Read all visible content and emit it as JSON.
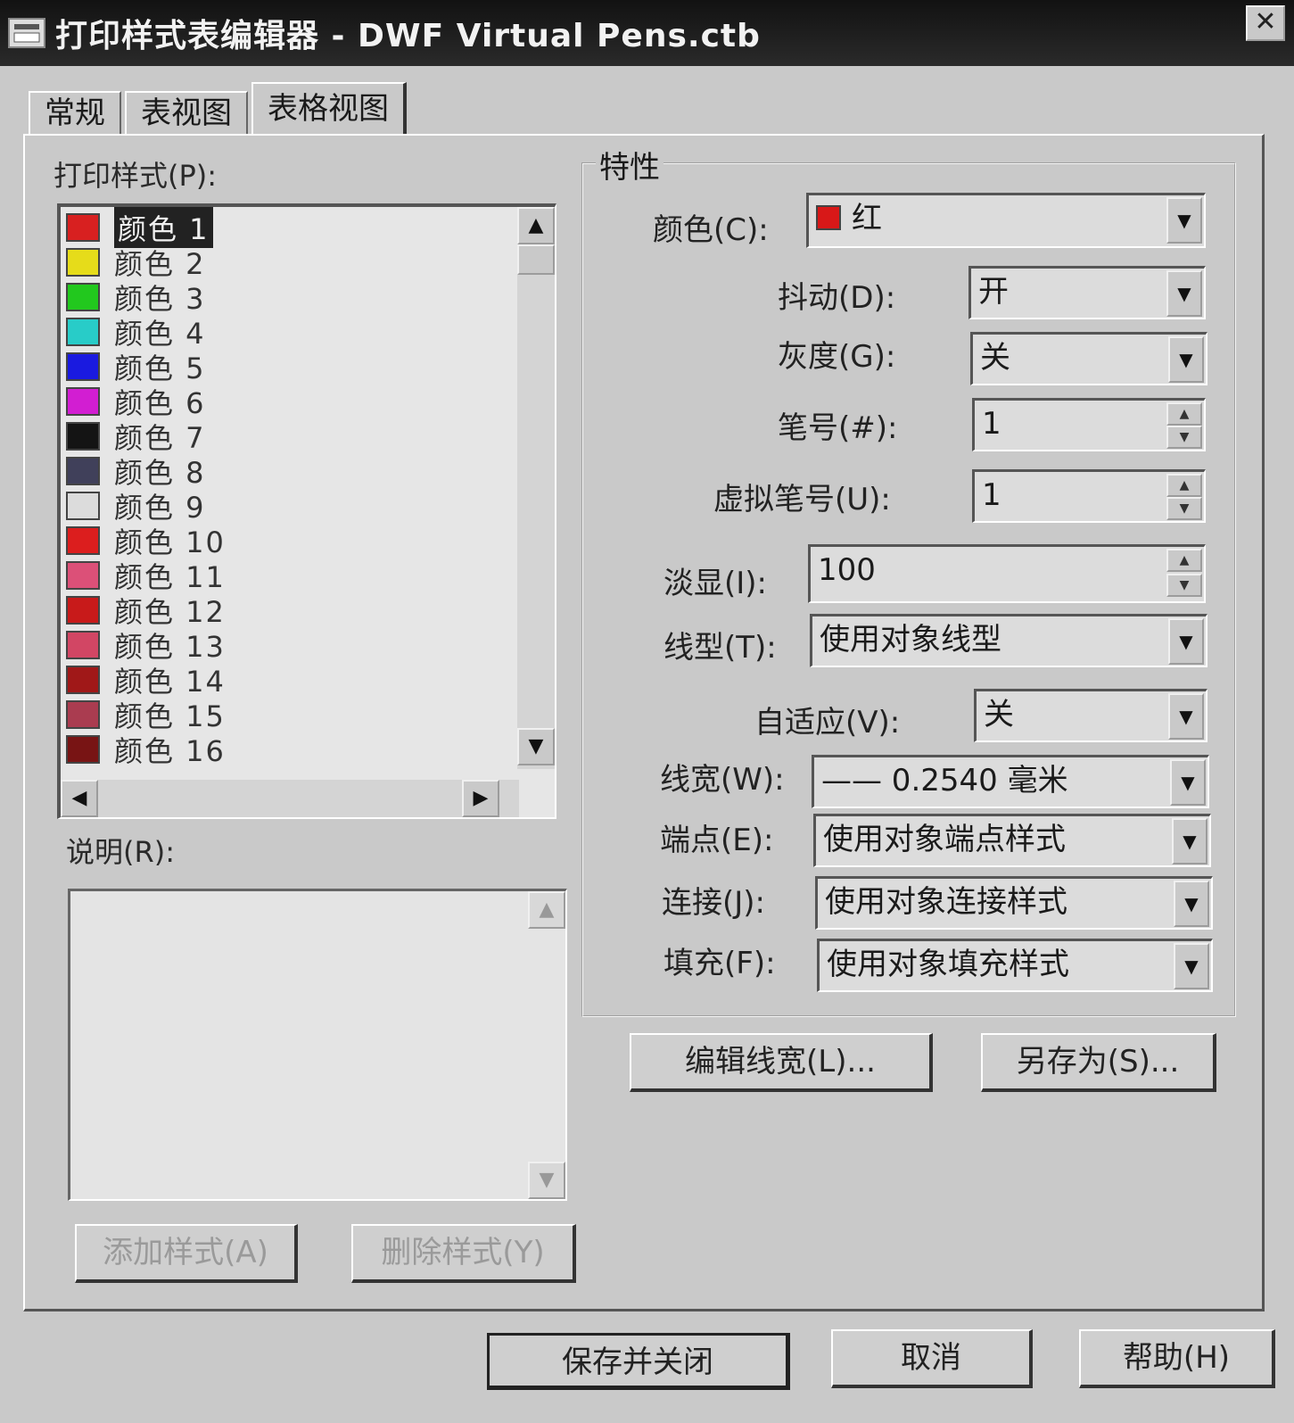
{
  "window": {
    "title": "打印样式表编辑器 - DWF Virtual Pens.ctb",
    "close_label": "✕"
  },
  "tabs": [
    {
      "label": "常规",
      "active": false
    },
    {
      "label": "表视图",
      "active": false
    },
    {
      "label": "表格视图",
      "active": true
    }
  ],
  "styles_panel": {
    "label": "打印样式(P):",
    "items": [
      {
        "name": "颜色 1",
        "color": "#d82020",
        "selected": true
      },
      {
        "name": "颜色 2",
        "color": "#e6dc1a"
      },
      {
        "name": "颜色 3",
        "color": "#22c81e"
      },
      {
        "name": "颜色 4",
        "color": "#28ccc8"
      },
      {
        "name": "颜色 5",
        "color": "#1a1ae0"
      },
      {
        "name": "颜色 6",
        "color": "#d21ed2"
      },
      {
        "name": "颜色 7",
        "color": "#141414"
      },
      {
        "name": "颜色 8",
        "color": "#40405a"
      },
      {
        "name": "颜色 9",
        "color": "#dcdcdc"
      },
      {
        "name": "颜色 10",
        "color": "#dc1e1e"
      },
      {
        "name": "颜色 11",
        "color": "#dc5078"
      },
      {
        "name": "颜色 12",
        "color": "#c81a1a"
      },
      {
        "name": "颜色 13",
        "color": "#d24664"
      },
      {
        "name": "颜色 14",
        "color": "#a01818"
      },
      {
        "name": "颜色 15",
        "color": "#aa3c50"
      },
      {
        "name": "颜色 16",
        "color": "#781414"
      }
    ],
    "description_label": "说明(R):",
    "add_button": "添加样式(A)",
    "delete_button": "删除样式(Y)"
  },
  "properties": {
    "group_title": "特性",
    "color": {
      "label": "颜色(C):",
      "value": "红",
      "chip_color": "#d81818"
    },
    "dither": {
      "label": "抖动(D):",
      "value": "开"
    },
    "grayscale": {
      "label": "灰度(G):",
      "value": "关"
    },
    "pen_number": {
      "label": "笔号(#):",
      "value": "1"
    },
    "virtual_pen": {
      "label": "虚拟笔号(U):",
      "value": "1"
    },
    "screening": {
      "label": "淡显(I):",
      "value": "100"
    },
    "linetype": {
      "label": "线型(T):",
      "value": "使用对象线型"
    },
    "adaptive": {
      "label": "自适应(V):",
      "value": "关"
    },
    "lineweight": {
      "label": "线宽(W):",
      "value": "—— 0.2540 毫米"
    },
    "line_end": {
      "label": "端点(E):",
      "value": "使用对象端点样式"
    },
    "line_join": {
      "label": "连接(J):",
      "value": "使用对象连接样式"
    },
    "fill": {
      "label": "填充(F):",
      "value": "使用对象填充样式"
    },
    "edit_lineweights_button": "编辑线宽(L)...",
    "save_as_button": "另存为(S)..."
  },
  "footer": {
    "save_close": "保存并关闭",
    "cancel": "取消",
    "help": "帮助(H)"
  }
}
